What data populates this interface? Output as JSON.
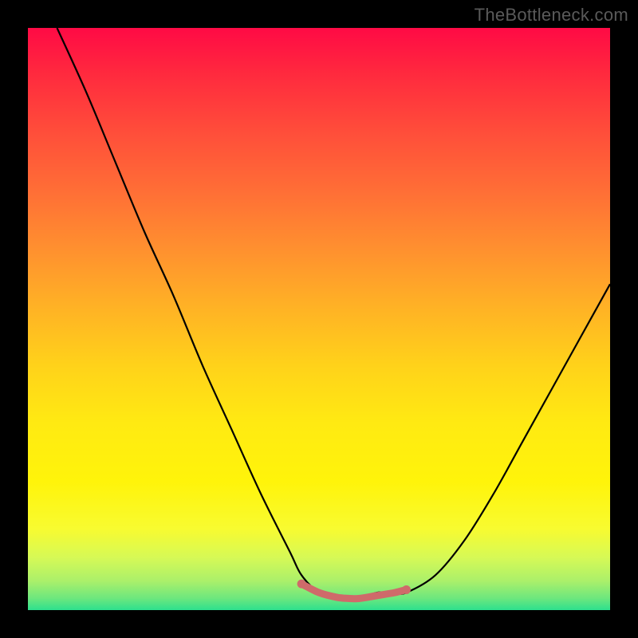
{
  "watermark": "TheBottleneck.com",
  "chart_data": {
    "type": "line",
    "title": "",
    "xlabel": "",
    "ylabel": "",
    "xlim": [
      0,
      100
    ],
    "ylim": [
      0,
      100
    ],
    "series": [
      {
        "name": "main-curve",
        "color": "#000000",
        "x": [
          5,
          10,
          15,
          20,
          25,
          30,
          35,
          40,
          45,
          47,
          50,
          53,
          55,
          57,
          60,
          63,
          65,
          70,
          75,
          80,
          85,
          90,
          95,
          100
        ],
        "y": [
          100,
          89,
          77,
          65,
          54,
          42,
          31,
          20,
          10,
          6,
          3,
          2,
          2,
          2,
          3,
          3,
          3,
          6,
          12,
          20,
          29,
          38,
          47,
          56
        ]
      },
      {
        "name": "bottom-highlight",
        "color": "#cf6a6a",
        "x": [
          47,
          50,
          53,
          55,
          57,
          60,
          63,
          65
        ],
        "y": [
          4.5,
          3,
          2.2,
          2,
          2,
          2.5,
          3,
          3.5
        ]
      }
    ],
    "gradient_stops": [
      {
        "pos": 0,
        "color": "#ff0a45"
      },
      {
        "pos": 8,
        "color": "#ff2a3e"
      },
      {
        "pos": 18,
        "color": "#ff4e3a"
      },
      {
        "pos": 28,
        "color": "#ff6e36"
      },
      {
        "pos": 38,
        "color": "#ff902f"
      },
      {
        "pos": 48,
        "color": "#ffb225"
      },
      {
        "pos": 58,
        "color": "#ffd21a"
      },
      {
        "pos": 68,
        "color": "#ffea12"
      },
      {
        "pos": 78,
        "color": "#fff40a"
      },
      {
        "pos": 86,
        "color": "#f8fb30"
      },
      {
        "pos": 91,
        "color": "#d6f956"
      },
      {
        "pos": 95,
        "color": "#abf06a"
      },
      {
        "pos": 98,
        "color": "#6ce77e"
      },
      {
        "pos": 100,
        "color": "#2de08e"
      }
    ]
  }
}
